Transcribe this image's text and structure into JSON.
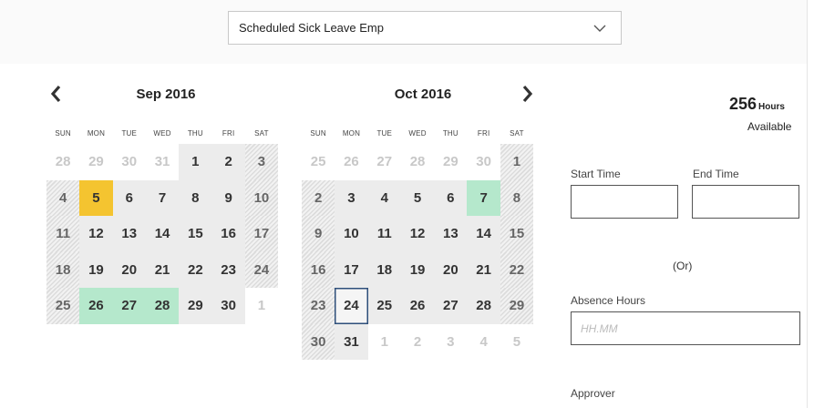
{
  "leave_type_select": {
    "value": "Scheduled Sick Leave Emp",
    "icon": "chevron-down-icon"
  },
  "navigation": {
    "prev_icon": "chevron-left-icon",
    "next_icon": "chevron-right-icon"
  },
  "weekday_headers": [
    "SUN",
    "MON",
    "TUE",
    "WED",
    "THU",
    "FRI",
    "SAT"
  ],
  "calendars": [
    {
      "title": "Sep 2016",
      "days": [
        {
          "label": "28",
          "kind": "out"
        },
        {
          "label": "29",
          "kind": "out"
        },
        {
          "label": "30",
          "kind": "out"
        },
        {
          "label": "31",
          "kind": "out"
        },
        {
          "label": "1",
          "kind": "wk"
        },
        {
          "label": "2",
          "kind": "wk"
        },
        {
          "label": "3",
          "kind": "we"
        },
        {
          "label": "4",
          "kind": "we"
        },
        {
          "label": "5",
          "kind": "sel"
        },
        {
          "label": "6",
          "kind": "wk"
        },
        {
          "label": "7",
          "kind": "wk"
        },
        {
          "label": "8",
          "kind": "wk"
        },
        {
          "label": "9",
          "kind": "wk"
        },
        {
          "label": "10",
          "kind": "we"
        },
        {
          "label": "11",
          "kind": "we"
        },
        {
          "label": "12",
          "kind": "wk"
        },
        {
          "label": "13",
          "kind": "wk"
        },
        {
          "label": "14",
          "kind": "wk"
        },
        {
          "label": "15",
          "kind": "wk"
        },
        {
          "label": "16",
          "kind": "wk"
        },
        {
          "label": "17",
          "kind": "we"
        },
        {
          "label": "18",
          "kind": "we"
        },
        {
          "label": "19",
          "kind": "wk"
        },
        {
          "label": "20",
          "kind": "wk"
        },
        {
          "label": "21",
          "kind": "wk"
        },
        {
          "label": "22",
          "kind": "wk"
        },
        {
          "label": "23",
          "kind": "wk"
        },
        {
          "label": "24",
          "kind": "we"
        },
        {
          "label": "25",
          "kind": "we"
        },
        {
          "label": "26",
          "kind": "leave"
        },
        {
          "label": "27",
          "kind": "leave"
        },
        {
          "label": "28",
          "kind": "leave"
        },
        {
          "label": "29",
          "kind": "wk"
        },
        {
          "label": "30",
          "kind": "wk"
        },
        {
          "label": "1",
          "kind": "out"
        }
      ]
    },
    {
      "title": "Oct 2016",
      "days": [
        {
          "label": "25",
          "kind": "out"
        },
        {
          "label": "26",
          "kind": "out"
        },
        {
          "label": "27",
          "kind": "out"
        },
        {
          "label": "28",
          "kind": "out"
        },
        {
          "label": "29",
          "kind": "out"
        },
        {
          "label": "30",
          "kind": "out"
        },
        {
          "label": "1",
          "kind": "we"
        },
        {
          "label": "2",
          "kind": "we"
        },
        {
          "label": "3",
          "kind": "wk"
        },
        {
          "label": "4",
          "kind": "wk"
        },
        {
          "label": "5",
          "kind": "wk"
        },
        {
          "label": "6",
          "kind": "wk"
        },
        {
          "label": "7",
          "kind": "leave"
        },
        {
          "label": "8",
          "kind": "we"
        },
        {
          "label": "9",
          "kind": "we"
        },
        {
          "label": "10",
          "kind": "wk"
        },
        {
          "label": "11",
          "kind": "wk"
        },
        {
          "label": "12",
          "kind": "wk"
        },
        {
          "label": "13",
          "kind": "wk"
        },
        {
          "label": "14",
          "kind": "wk"
        },
        {
          "label": "15",
          "kind": "we"
        },
        {
          "label": "16",
          "kind": "we"
        },
        {
          "label": "17",
          "kind": "wk"
        },
        {
          "label": "18",
          "kind": "wk"
        },
        {
          "label": "19",
          "kind": "wk"
        },
        {
          "label": "20",
          "kind": "wk"
        },
        {
          "label": "21",
          "kind": "wk"
        },
        {
          "label": "22",
          "kind": "we"
        },
        {
          "label": "23",
          "kind": "we"
        },
        {
          "label": "24",
          "kind": "today"
        },
        {
          "label": "25",
          "kind": "wk"
        },
        {
          "label": "26",
          "kind": "wk"
        },
        {
          "label": "27",
          "kind": "wk"
        },
        {
          "label": "28",
          "kind": "wk"
        },
        {
          "label": "29",
          "kind": "we"
        },
        {
          "label": "30",
          "kind": "we"
        },
        {
          "label": "31",
          "kind": "wk"
        },
        {
          "label": "1",
          "kind": "out"
        },
        {
          "label": "2",
          "kind": "out"
        },
        {
          "label": "3",
          "kind": "out"
        },
        {
          "label": "4",
          "kind": "out"
        },
        {
          "label": "5",
          "kind": "out"
        }
      ]
    }
  ],
  "balance": {
    "hours": "256",
    "unit": "Hours",
    "available_label": "Available"
  },
  "form": {
    "start_time_label": "Start Time",
    "start_time_value": "",
    "end_time_label": "End Time",
    "end_time_value": "",
    "or_label": "(Or)",
    "absence_hours_label": "Absence Hours",
    "absence_hours_placeholder": "HH.MM",
    "absence_hours_value": "",
    "approver_label": "Approver"
  },
  "colors": {
    "selected_day": "#f4c430",
    "leave_day": "#b5e8cc",
    "today_border": "#2e4f7a",
    "weekday_bg": "#ececec"
  }
}
